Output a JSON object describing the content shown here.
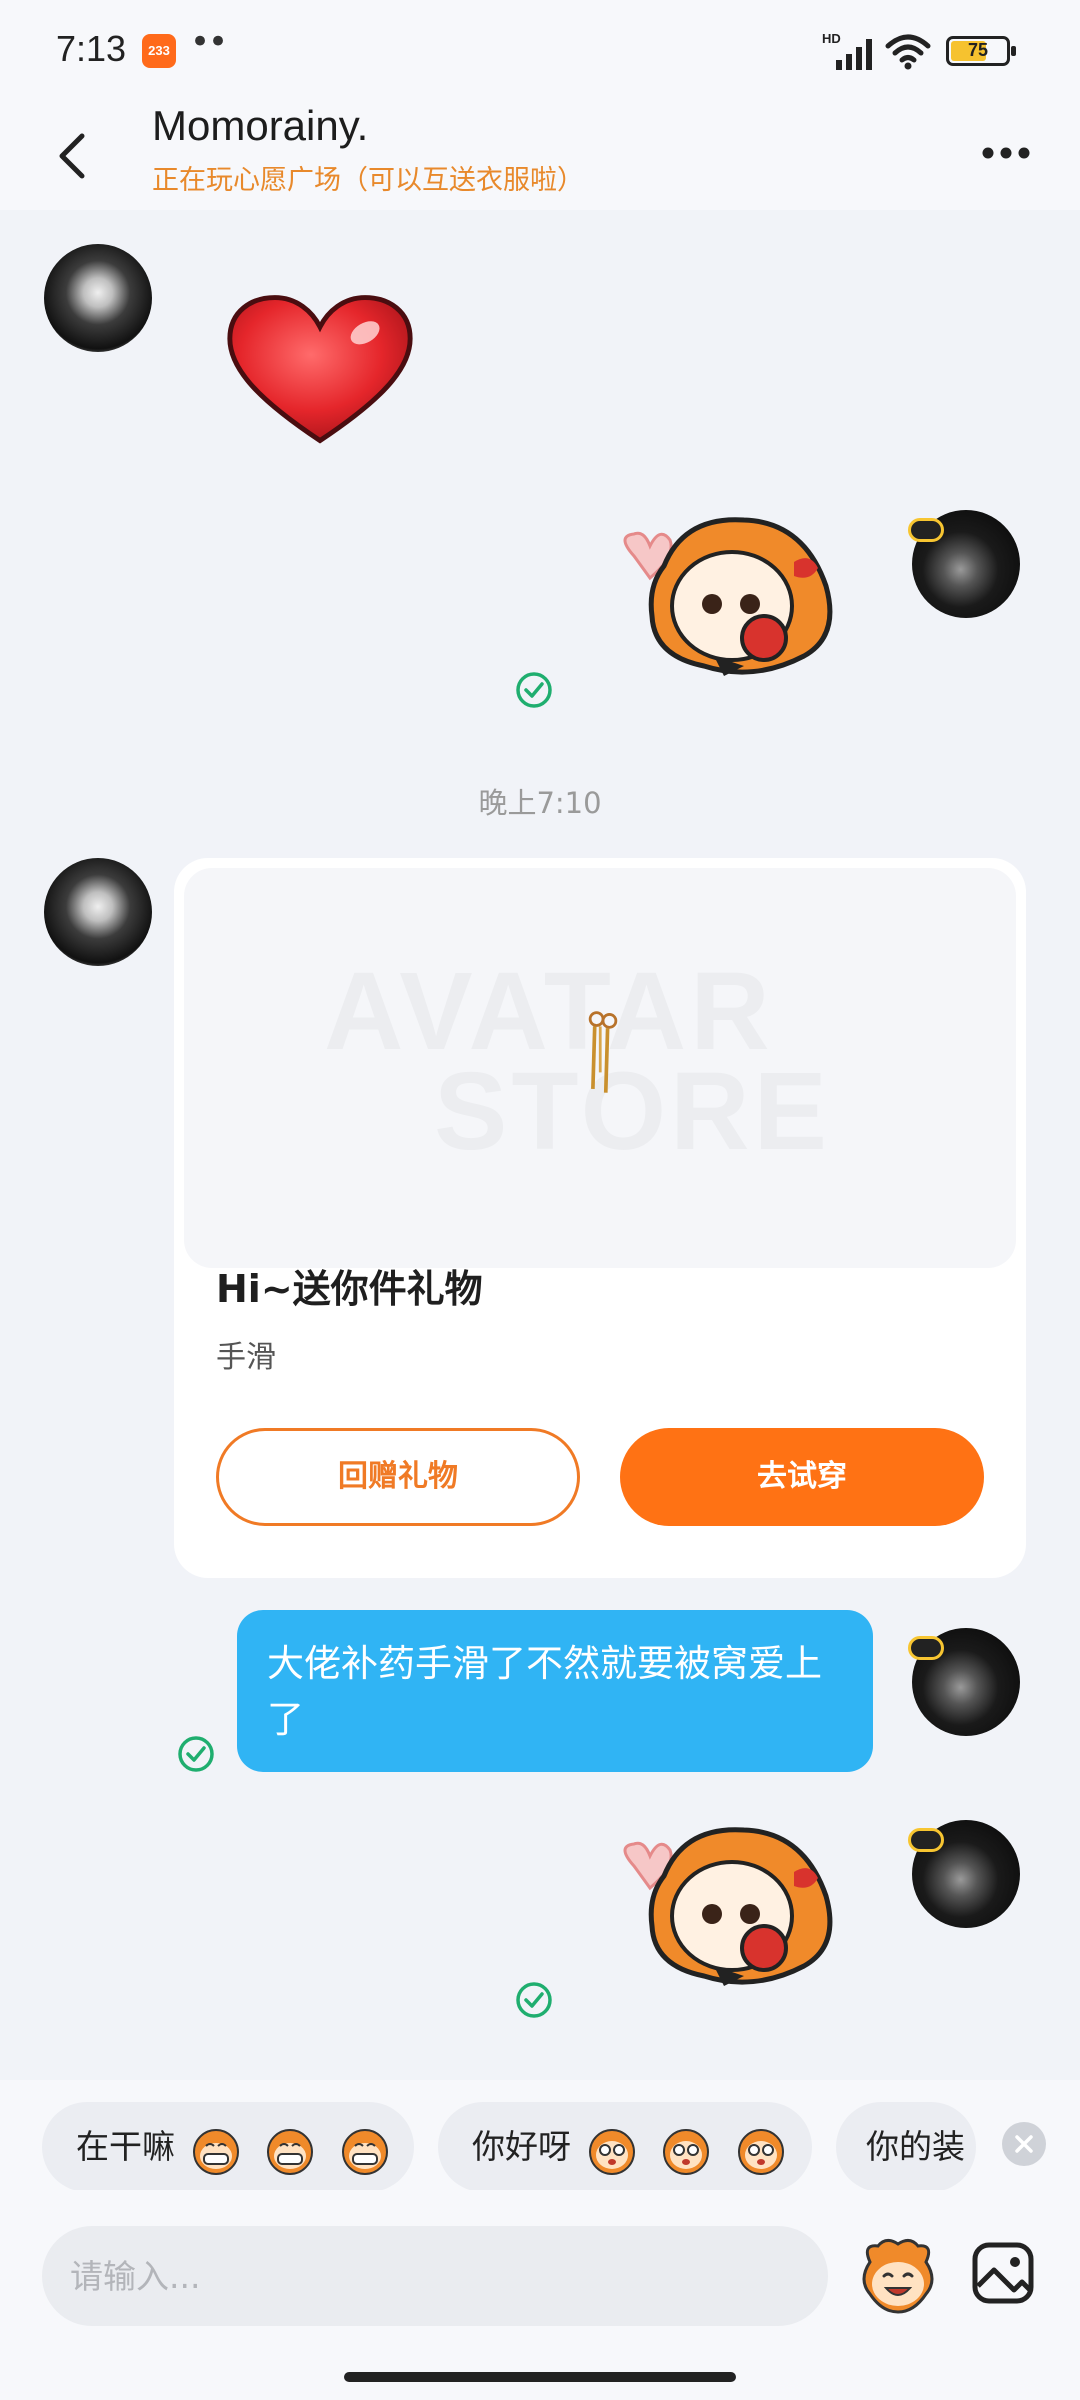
{
  "status_bar": {
    "time": "7:13",
    "app_badge": "233",
    "network": "HD",
    "battery": "75",
    "battery_level_percent": 75
  },
  "header": {
    "contact_name": "Momorainy.",
    "contact_status": "正在玩心愿广场（可以互送衣服啦）"
  },
  "messages": {
    "timestamp": "晚上7:10",
    "gift_card": {
      "preview_watermark_line1": "AVATAR",
      "preview_watermark_line2": "STORE",
      "title": "Hi~送你件礼物",
      "subtitle": "手滑",
      "return_gift_label": "回赠礼物",
      "try_on_label": "去试穿"
    },
    "text_message": "大佬补药手滑了不然就要被窝爱上了"
  },
  "quick_replies": [
    {
      "text": "在干嘛",
      "emoji": "grinning-monkey-emoji"
    },
    {
      "text": "你好呀",
      "emoji": "surprised-monkey-emoji"
    },
    {
      "text": "你的装"
    }
  ],
  "input": {
    "placeholder": "请输入..."
  },
  "icons": {
    "back": "back-arrow-icon",
    "more": "more-dots-icon",
    "sent": "check-icon",
    "emoji": "monkey-emoji-icon",
    "image": "image-icon",
    "close": "close-icon"
  },
  "colors": {
    "accent": "#ff7214",
    "status_text": "#e8892b",
    "bubble": "#30b4f4",
    "sent_check": "#1fae6f"
  }
}
